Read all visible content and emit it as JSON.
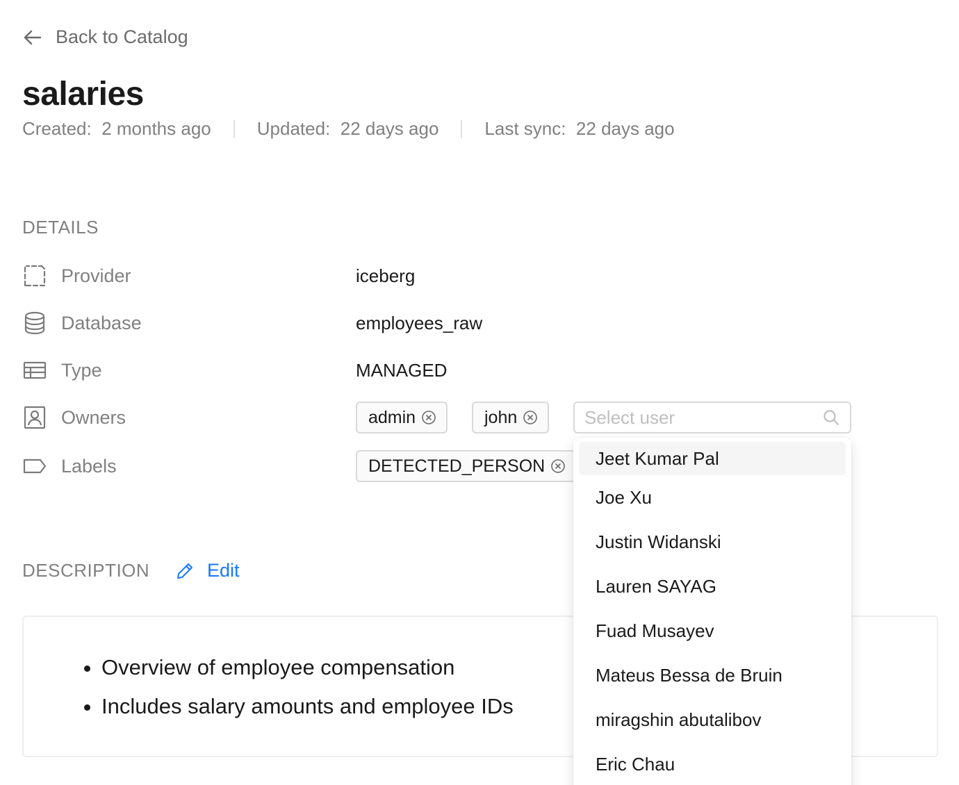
{
  "nav": {
    "back_label": "Back to Catalog"
  },
  "header": {
    "title": "salaries",
    "created_label": "Created:",
    "created_value": "2 months ago",
    "updated_label": "Updated:",
    "updated_value": "22 days ago",
    "sync_label": "Last sync:",
    "sync_value": "22 days ago"
  },
  "details": {
    "heading": "DETAILS",
    "provider": {
      "label": "Provider",
      "value": "iceberg",
      "icon": "dashed-square-icon"
    },
    "database": {
      "label": "Database",
      "value": "employees_raw",
      "icon": "database-icon"
    },
    "type": {
      "label": "Type",
      "value": "MANAGED",
      "icon": "table-icon"
    },
    "owners": {
      "label": "Owners",
      "icon": "user-card-icon",
      "tags": [
        "admin",
        "john"
      ],
      "select_placeholder": "Select user"
    },
    "labels": {
      "label": "Labels",
      "icon": "tag-icon",
      "tags": [
        "DETECTED_PERSON"
      ]
    }
  },
  "user_dropdown": {
    "options": [
      "Jeet Kumar Pal",
      "Joe Xu",
      "Justin Widanski",
      "Lauren SAYAG",
      "Fuad Musayev",
      "Mateus Bessa de Bruin",
      "miragshin abutalibov",
      "Eric Chau"
    ],
    "highlighted_index": 0
  },
  "description": {
    "heading": "DESCRIPTION",
    "edit_label": "Edit",
    "bullets": [
      "Overview of employee compensation",
      "Includes salary amounts and employee IDs"
    ]
  },
  "colors": {
    "accent": "#1677ff",
    "muted": "#808080",
    "border": "#d9d9d9"
  }
}
